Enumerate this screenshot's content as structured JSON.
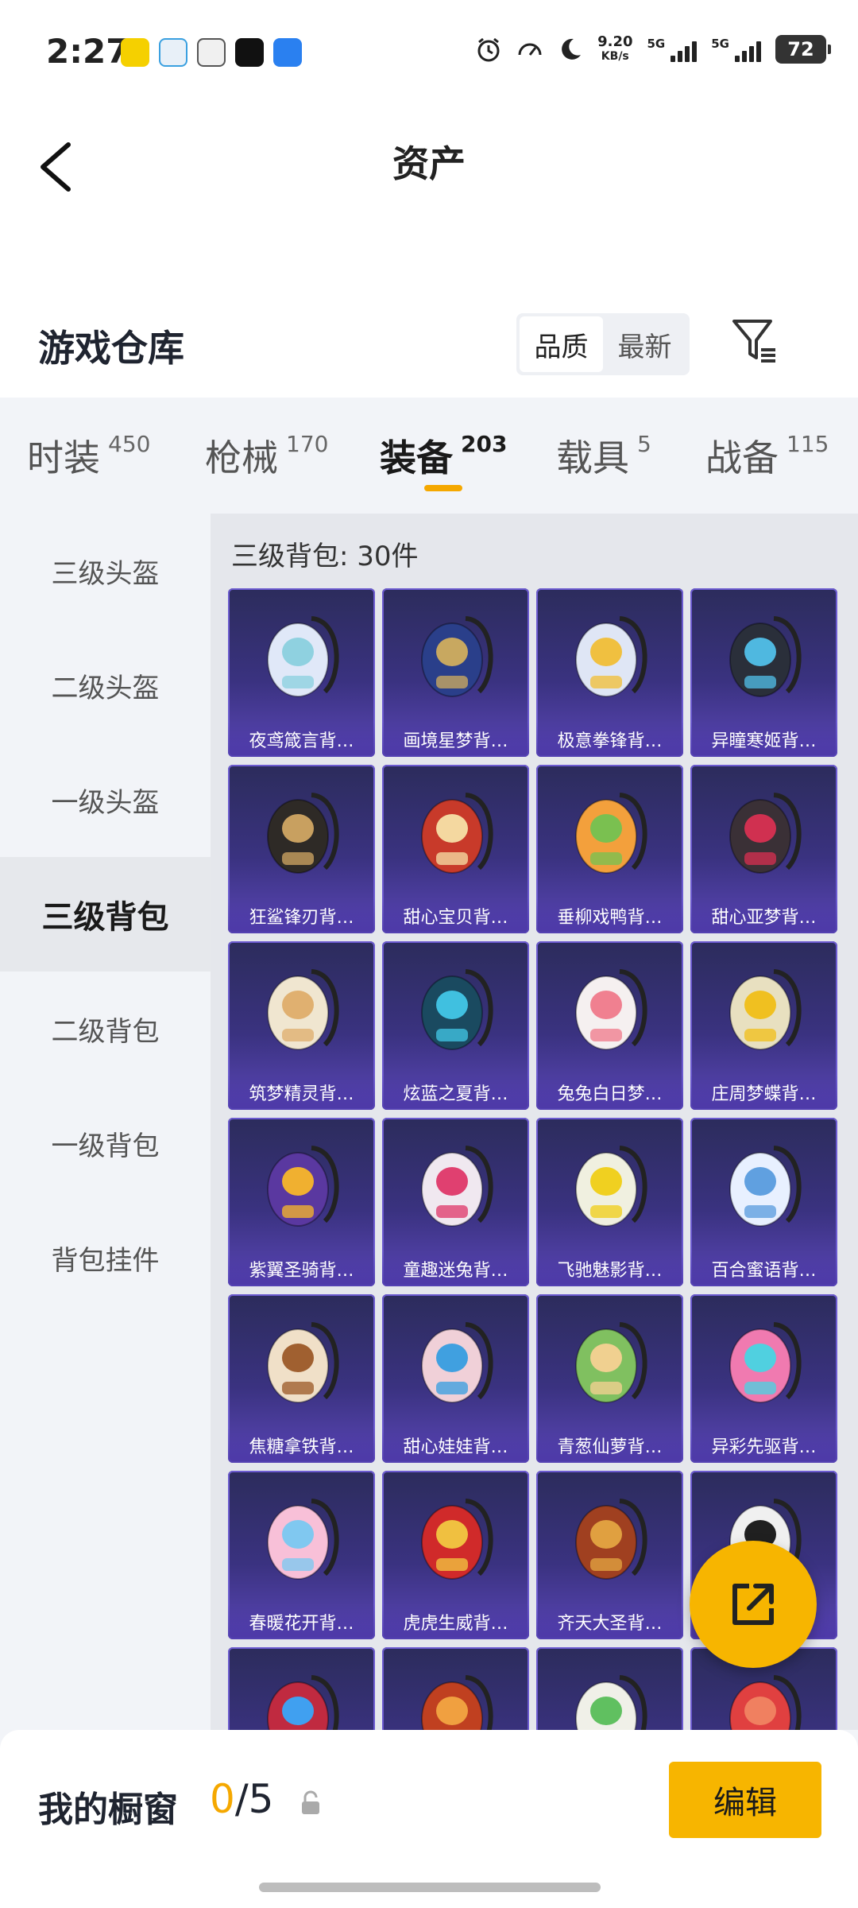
{
  "status_bar": {
    "time": "2:27",
    "net_speed_value": "9.20",
    "net_speed_unit": "KB/s",
    "signal1_label": "5G",
    "signal2_label": "5G",
    "battery": "72"
  },
  "header": {
    "title": "资产"
  },
  "warehouse": {
    "title": "游戏仓库",
    "sort_options": [
      "品质",
      "最新"
    ],
    "sort_selected": "品质"
  },
  "tabs": [
    {
      "label": "时装",
      "count": "450"
    },
    {
      "label": "枪械",
      "count": "170"
    },
    {
      "label": "装备",
      "count": "203"
    },
    {
      "label": "载具",
      "count": "5"
    },
    {
      "label": "战备",
      "count": "115"
    }
  ],
  "tab_selected": "装备",
  "sidebar": {
    "items": [
      "三级头盔",
      "二级头盔",
      "一级头盔",
      "三级背包",
      "二级背包",
      "一级背包",
      "背包挂件"
    ],
    "selected": "三级背包"
  },
  "content": {
    "category_heading": "三级背包: 30件",
    "items": [
      {
        "name": "夜鸢箴言背…",
        "color": "#e0e8f8",
        "accent": "#8fd1e0"
      },
      {
        "name": "画境星梦背…",
        "color": "#2a3f8a",
        "accent": "#c8a860"
      },
      {
        "name": "极意拳锋背…",
        "color": "#dfe6f5",
        "accent": "#f0c040"
      },
      {
        "name": "异瞳寒姬背…",
        "color": "#2a2f3a",
        "accent": "#4fb8e0"
      },
      {
        "name": "狂鲨锋刃背…",
        "color": "#2e2a26",
        "accent": "#c8a060"
      },
      {
        "name": "甜心宝贝背…",
        "color": "#c83a2a",
        "accent": "#f4d8a0"
      },
      {
        "name": "垂柳戏鸭背…",
        "color": "#f3a03c",
        "accent": "#7ac050"
      },
      {
        "name": "甜心亚梦背…",
        "color": "#3a3036",
        "accent": "#d03050"
      },
      {
        "name": "筑梦精灵背…",
        "color": "#f0e6d0",
        "accent": "#e0b070"
      },
      {
        "name": "炫蓝之夏背…",
        "color": "#1a4a60",
        "accent": "#40c0e0"
      },
      {
        "name": "兔兔白日梦…",
        "color": "#f5f0f0",
        "accent": "#f08090"
      },
      {
        "name": "庄周梦蝶背…",
        "color": "#e8e0c0",
        "accent": "#f0c020"
      },
      {
        "name": "紫翼圣骑背…",
        "color": "#5a38a0",
        "accent": "#f0b030"
      },
      {
        "name": "童趣迷兔背…",
        "color": "#f0e8f0",
        "accent": "#e04070"
      },
      {
        "name": "飞驰魅影背…",
        "color": "#f0f0e0",
        "accent": "#f0d020"
      },
      {
        "name": "百合蜜语背…",
        "color": "#e8f0ff",
        "accent": "#60a0e0"
      },
      {
        "name": "焦糖拿铁背…",
        "color": "#f0e0c8",
        "accent": "#a06030"
      },
      {
        "name": "甜心娃娃背…",
        "color": "#f0d0d8",
        "accent": "#40a0e0"
      },
      {
        "name": "青葱仙萝背…",
        "color": "#80c060",
        "accent": "#f0d090"
      },
      {
        "name": "异彩先驱背…",
        "color": "#f07ab0",
        "accent": "#50d0e0"
      },
      {
        "name": "春暖花开背…",
        "color": "#f8c0d8",
        "accent": "#80c8f0"
      },
      {
        "name": "虎虎生威背…",
        "color": "#d02a2a",
        "accent": "#f0c040"
      },
      {
        "name": "齐天大圣背…",
        "color": "#a04020",
        "accent": "#e0a040"
      },
      {
        "name": "",
        "color": "#f0f0f0",
        "accent": "#202020"
      },
      {
        "name": "",
        "color": "#c02a40",
        "accent": "#40a0f0"
      },
      {
        "name": "",
        "color": "#c04020",
        "accent": "#f0a040"
      },
      {
        "name": "",
        "color": "#f0f0e8",
        "accent": "#60c060"
      },
      {
        "name": "",
        "color": "#e04040",
        "accent": "#f08060"
      }
    ]
  },
  "bottom": {
    "label": "我的橱窗",
    "count_current": "0",
    "count_total": "/5",
    "edit_label": "编辑"
  },
  "colors": {
    "accent": "#f7b500",
    "card_top": "#2c2c5c",
    "card_bottom": "#5a46b6"
  }
}
